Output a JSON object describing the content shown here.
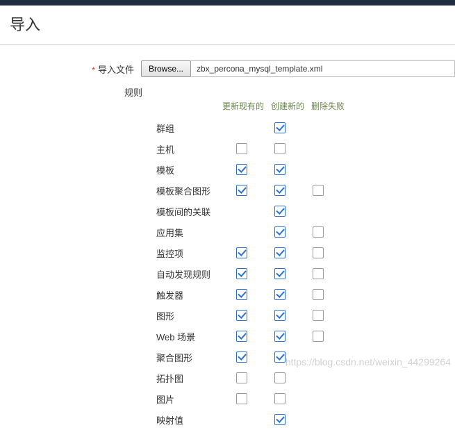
{
  "page": {
    "title": "导入"
  },
  "form": {
    "import_label": "导入文件",
    "browse_label": "Browse...",
    "file_name": "zbx_percona_mysql_template.xml",
    "rules_label": "规则"
  },
  "rules_header": {
    "col_update": "更新现有的",
    "col_create": "创建新的",
    "col_delete": "删除失败"
  },
  "rules": [
    {
      "label": "群组",
      "update": null,
      "create": true,
      "delete": null
    },
    {
      "label": "主机",
      "update": false,
      "create": false,
      "delete": null
    },
    {
      "label": "模板",
      "update": true,
      "create": true,
      "delete": null
    },
    {
      "label": "模板聚合图形",
      "update": true,
      "create": true,
      "delete": false
    },
    {
      "label": "模板间的关联",
      "update": null,
      "create": true,
      "delete": null
    },
    {
      "label": "应用集",
      "update": null,
      "create": true,
      "delete": false
    },
    {
      "label": "监控项",
      "update": true,
      "create": true,
      "delete": false
    },
    {
      "label": "自动发现规则",
      "update": true,
      "create": true,
      "delete": false
    },
    {
      "label": "触发器",
      "update": true,
      "create": true,
      "delete": false
    },
    {
      "label": "图形",
      "update": true,
      "create": true,
      "delete": false
    },
    {
      "label": "Web 场景",
      "update": true,
      "create": true,
      "delete": false
    },
    {
      "label": "聚合图形",
      "update": true,
      "create": true,
      "delete": null
    },
    {
      "label": "拓扑图",
      "update": false,
      "create": false,
      "delete": null
    },
    {
      "label": "图片",
      "update": false,
      "create": false,
      "delete": null
    },
    {
      "label": "映射值",
      "update": null,
      "create": true,
      "delete": null
    }
  ],
  "watermark": "https://blog.csdn.net/weixin_44299264"
}
